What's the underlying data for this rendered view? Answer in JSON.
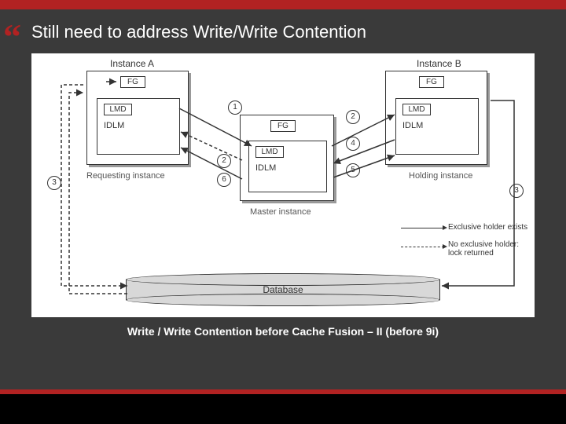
{
  "slide": {
    "title": "Still need to address Write/Write Contention",
    "bullet_glyph": "“",
    "caption": "Write / Write Contention before Cache Fusion – II (before 9i)"
  },
  "diagram": {
    "instance_a": {
      "label": "Instance A",
      "fg": "FG",
      "lmd": "LMD",
      "idlm": "IDLM",
      "role": "Requesting instance"
    },
    "instance_b": {
      "label": "Instance B",
      "fg": "FG",
      "lmd": "LMD",
      "idlm": "IDLM",
      "role": "Holding instance"
    },
    "master": {
      "fg": "FG",
      "lmd": "LMD",
      "idlm": "IDLM",
      "role": "Master instance"
    },
    "steps": {
      "s1": "1",
      "s2a": "2",
      "s2b": "2",
      "s3a": "3",
      "s3b": "3",
      "s4": "4",
      "s5": "5",
      "s6": "6"
    },
    "database": "Database",
    "legend": {
      "solid": "Exclusive holder exists",
      "dashed": "No exclusive holder: lock returned"
    }
  },
  "colors": {
    "accent_red": "#b22222",
    "bg_dark": "#3a3a3a"
  }
}
